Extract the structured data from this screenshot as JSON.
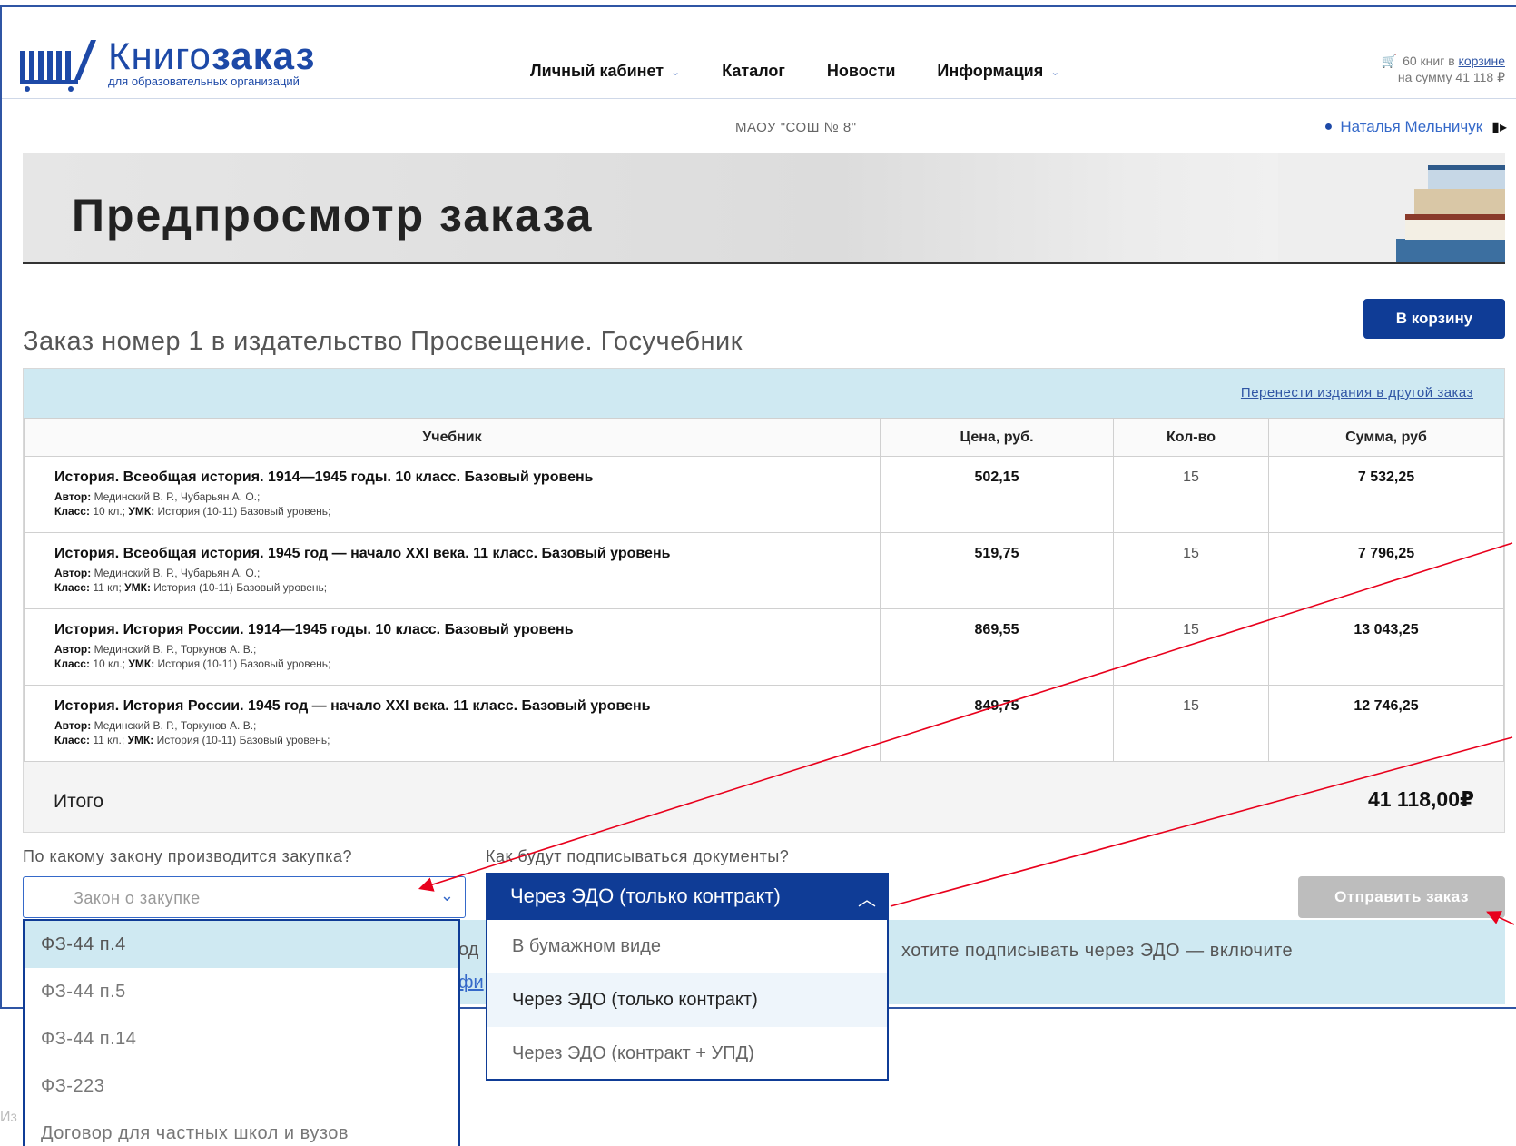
{
  "header": {
    "logo_name_light": "Книго",
    "logo_name_bold": "заказ",
    "logo_sub": "для образовательных организаций",
    "nav": [
      {
        "label": "Личный кабинет",
        "has_dropdown": true
      },
      {
        "label": "Каталог",
        "has_dropdown": false
      },
      {
        "label": "Новости",
        "has_dropdown": false
      },
      {
        "label": "Информация",
        "has_dropdown": true
      }
    ],
    "cart_line1_prefix": "60 книг в",
    "cart_link": "корзине",
    "cart_line2": "на сумму 41 118 ₽",
    "school": "МАОУ \"СОШ № 8\"",
    "user": "Наталья Мельничук"
  },
  "banner": {
    "title": "Предпросмотр заказа"
  },
  "order": {
    "to_cart_button": "В корзину",
    "title": "Заказ номер 1 в издательство Просвещение. Госучебник",
    "move_link": "Перенести издания в другой заказ",
    "columns": [
      "Учебник",
      "Цена, руб.",
      "Кол-во",
      "Сумма, руб"
    ],
    "rows": [
      {
        "title": "История. Всеобщая история. 1914—1945 годы. 10 класс. Базовый уровень",
        "author_label": "Автор:",
        "author": "Мединский В. Р., Чубарьян А. О.;",
        "class_label": "Класс:",
        "class": "10 кл.;",
        "umk_label": "УМК:",
        "umk": "История (10-11) Базовый уровень;",
        "price": "502,15",
        "qty": "15",
        "sum": "7 532,25"
      },
      {
        "title": "История. Всеобщая история. 1945 год — начало XXI века. 11 класс. Базовый уровень",
        "author_label": "Автор:",
        "author": "Мединский В. Р., Чубарьян А. О.;",
        "class_label": "Класс:",
        "class": "11 кл;",
        "umk_label": "УМК:",
        "umk": "История (10-11) Базовый уровень;",
        "price": "519,75",
        "qty": "15",
        "sum": "7 796,25"
      },
      {
        "title": "История. История России. 1914—1945 годы. 10 класс. Базовый уровень",
        "author_label": "Автор:",
        "author": "Мединский В. Р., Торкунов А. В.;",
        "class_label": "Класс:",
        "class": "10 кл.;",
        "umk_label": "УМК:",
        "umk": "История (10-11) Базовый уровень;",
        "price": "869,55",
        "qty": "15",
        "sum": "13 043,25"
      },
      {
        "title": "История. История России. 1945 год — начало XXI века. 11 класс. Базовый уровень",
        "author_label": "Автор:",
        "author": "Мединский В. Р., Торкунов А. В.;",
        "class_label": "Класс:",
        "class": "11 кл.;",
        "umk_label": "УМК:",
        "umk": "История (10-11) Базовый уровень;",
        "price": "849,75",
        "qty": "15",
        "sum": "12 746,25"
      }
    ],
    "total_label": "Итого",
    "total_value": "41 118,00₽"
  },
  "form": {
    "law_question": "По какому закону производится закупка?",
    "sign_question": "Как будут подписываться документы?",
    "law_placeholder": "Закон о закупке",
    "law_options": [
      "ФЗ-44 п.4",
      "ФЗ-44 п.5",
      "ФЗ-44 п.14",
      "ФЗ-223",
      "Договор для частных школ и вузов"
    ],
    "sign_selected": "Через ЭДО (только контракт)",
    "sign_options": [
      "В бумажном виде",
      "Через ЭДО (только контракт)",
      "Через ЭДО (контракт + УПД)"
    ],
    "info_frag": "од",
    "info_frag2": "фи",
    "info_text": "хотите подписывать через ЭДО — включите",
    "send_button": "Отправить заказ",
    "footer_frag": "Из"
  },
  "colors": {
    "brand_blue": "#0f3c96",
    "link_blue": "#2f55a4",
    "info_bg": "#cfe9f2",
    "annotation_red": "#e8001c",
    "disabled_gray": "#bdbdbd"
  }
}
